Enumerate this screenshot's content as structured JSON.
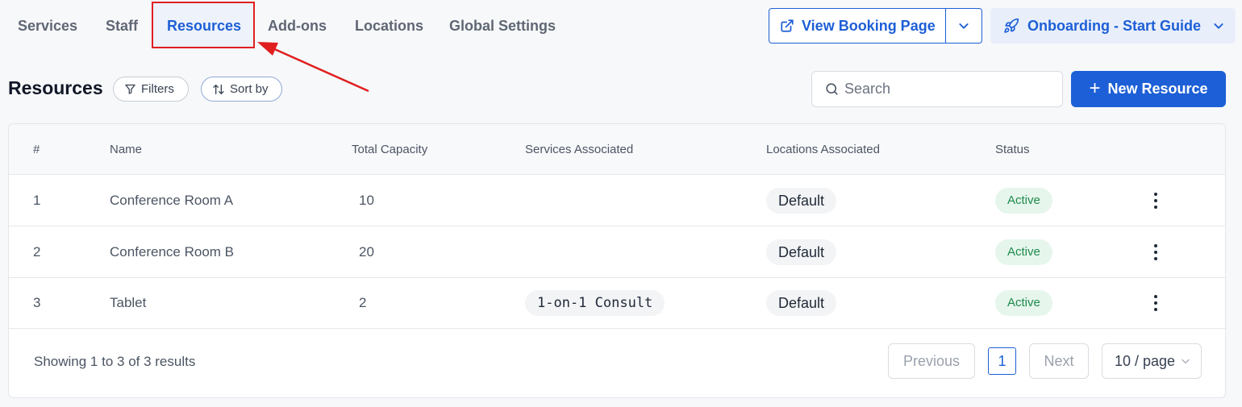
{
  "tabs": [
    {
      "label": "Services",
      "active": false
    },
    {
      "label": "Staff",
      "active": false
    },
    {
      "label": "Resources",
      "active": true
    },
    {
      "label": "Add-ons",
      "active": false
    },
    {
      "label": "Locations",
      "active": false
    },
    {
      "label": "Global Settings",
      "active": false
    }
  ],
  "header": {
    "view_booking_label": "View Booking Page",
    "onboarding_label": "Onboarding - Start Guide"
  },
  "toolbar": {
    "title": "Resources",
    "filters_label": "Filters",
    "sort_label": "Sort by",
    "search_placeholder": "Search",
    "new_label": "New Resource"
  },
  "table": {
    "columns": [
      "#",
      "Name",
      "Total Capacity",
      "Services Associated",
      "Locations Associated",
      "Status"
    ],
    "rows": [
      {
        "num": "1",
        "name": "Conference Room A",
        "capacity": "10",
        "services": "",
        "location": "Default",
        "status": "Active"
      },
      {
        "num": "2",
        "name": "Conference Room B",
        "capacity": "20",
        "services": "",
        "location": "Default",
        "status": "Active"
      },
      {
        "num": "3",
        "name": "Tablet",
        "capacity": "2",
        "services": "1-on-1 Consult",
        "location": "Default",
        "status": "Active"
      }
    ]
  },
  "pagination": {
    "summary": "Showing 1 to 3 of 3 results",
    "previous_label": "Previous",
    "current_page": "1",
    "next_label": "Next",
    "page_size": "10 / page"
  },
  "colors": {
    "accent": "#1d5fd6",
    "highlight_annotation": "#e01f1f",
    "status_active_text": "#1e8a4c",
    "status_active_bg": "#e6f6ec"
  }
}
